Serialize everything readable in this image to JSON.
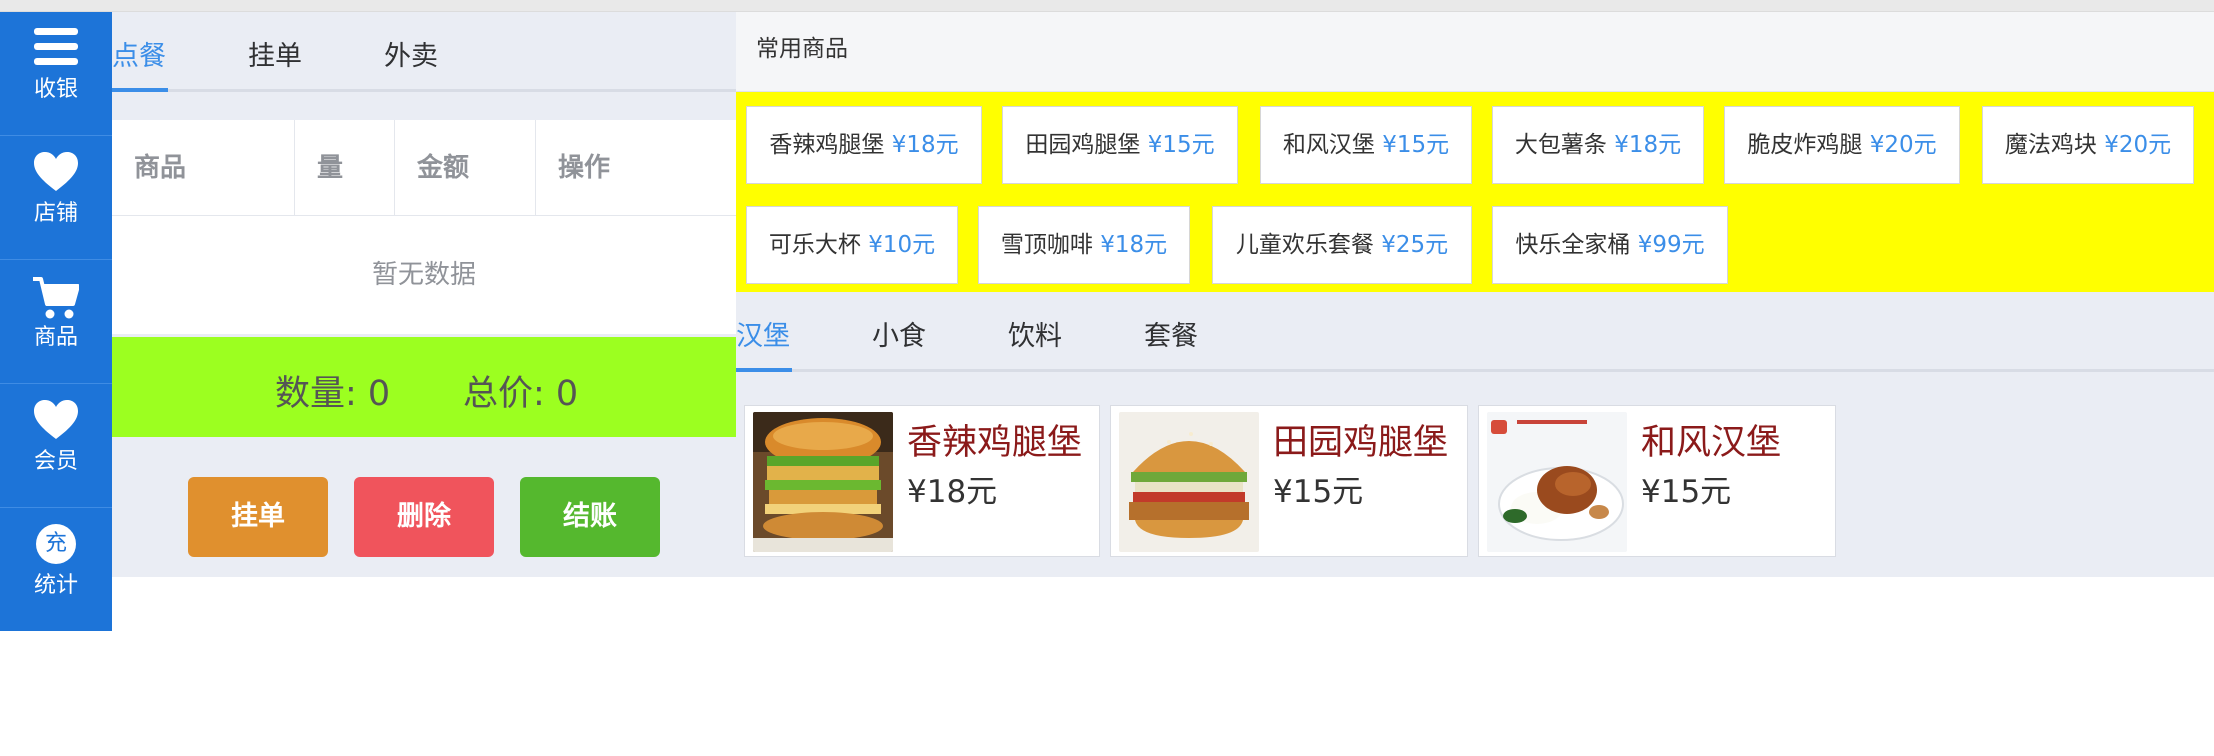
{
  "nav": [
    {
      "icon": "menu-icon",
      "label": "收银"
    },
    {
      "icon": "heart-icon",
      "label": "店铺"
    },
    {
      "icon": "cart-icon",
      "label": "商品"
    },
    {
      "icon": "heart-icon",
      "label": "会员"
    },
    {
      "icon": "charge-icon",
      "label": "统计",
      "glyph": "充"
    }
  ],
  "order": {
    "tabs": [
      "点餐",
      "挂单",
      "外卖"
    ],
    "active_tab": 0,
    "columns": [
      "商品",
      "量",
      "金额",
      "操作"
    ],
    "empty_text": "暂无数据",
    "count_label": "数量: 0",
    "total_label": "总价: 0",
    "buttons": [
      {
        "label": "挂单",
        "color": "#e0902e"
      },
      {
        "label": "删除",
        "color": "#f0545c"
      },
      {
        "label": "结账",
        "color": "#55b82e"
      }
    ]
  },
  "common": {
    "title": "常用商品",
    "items": [
      {
        "name": "香辣鸡腿堡",
        "price": "¥18元"
      },
      {
        "name": "田园鸡腿堡",
        "price": "¥15元"
      },
      {
        "name": "和风汉堡",
        "price": "¥15元"
      },
      {
        "name": "大包薯条",
        "price": "¥18元"
      },
      {
        "name": "脆皮炸鸡腿",
        "price": "¥20元"
      },
      {
        "name": "魔法鸡块",
        "price": "¥20元"
      },
      {
        "name": "可乐大杯",
        "price": "¥10元"
      },
      {
        "name": "雪顶咖啡",
        "price": "¥18元"
      },
      {
        "name": "儿童欢乐套餐",
        "price": "¥25元"
      },
      {
        "name": "快乐全家桶",
        "price": "¥99元"
      }
    ]
  },
  "categories": {
    "tabs": [
      "汉堡",
      "小食",
      "饮料",
      "套餐"
    ],
    "active_tab": 0
  },
  "products": [
    {
      "name": "香辣鸡腿堡",
      "price": "¥18元",
      "image": "stacked-burger-image"
    },
    {
      "name": "田园鸡腿堡",
      "price": "¥15元",
      "image": "chicken-burger-image"
    },
    {
      "name": "和风汉堡",
      "price": "¥15元",
      "image": "fried-chicken-plate-image"
    }
  ],
  "colors": {
    "nav_bg": "#1d74d8",
    "accent": "#3b8ee8",
    "totals_bg": "#9cff20",
    "common_bg": "#ffff00",
    "product_name": "#8b1a1a"
  }
}
